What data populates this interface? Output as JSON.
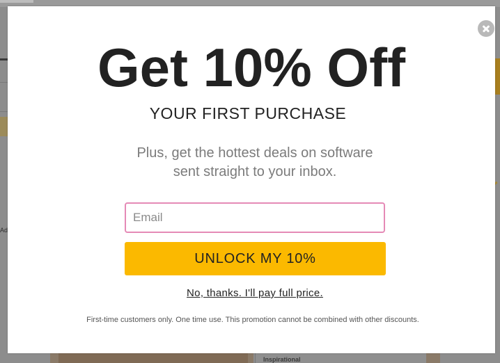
{
  "background": {
    "ad_text": "Ad",
    "card_label": "Inspirational"
  },
  "modal": {
    "headline": "Get 10% Off",
    "subheadline": "YOUR FIRST PURCHASE",
    "description_line1": "Plus, get the hottest deals on software",
    "description_line2": "sent straight to your inbox.",
    "email": {
      "placeholder": "Email",
      "value": ""
    },
    "cta_label": "UNLOCK MY 10%",
    "decline_label": "No, thanks. I'll pay full price.",
    "disclaimer": "First-time customers only. One time use. This promotion cannot be combined with other discounts.",
    "close_icon": "close-icon"
  },
  "colors": {
    "cta": "#fbb900",
    "input_border": "#e58ab6",
    "overlay": "#8c8c8c"
  }
}
